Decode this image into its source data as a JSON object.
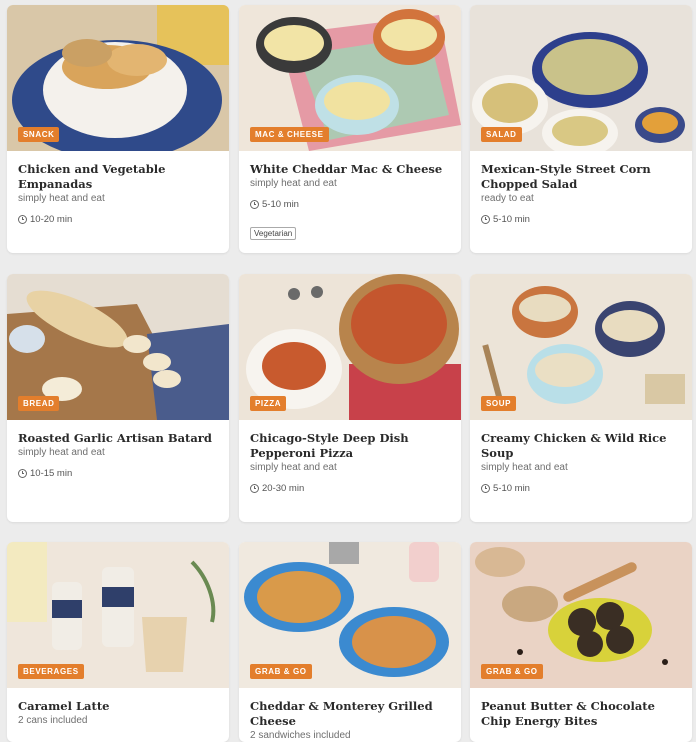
{
  "cards": [
    {
      "title": "Chicken and Vegetable Empanadas",
      "sub": "simply heat and eat",
      "time": "10-20 min",
      "badge": "SNACK"
    },
    {
      "title": "White Cheddar Mac & Cheese",
      "sub": "simply heat and eat",
      "time": "5-10 min",
      "badge": "MAC & CHEESE",
      "tag": "Vegetarian"
    },
    {
      "title": "Mexican-Style Street Corn Chopped Salad",
      "sub": "ready to eat",
      "time": "5-10 min",
      "badge": "SALAD"
    },
    {
      "title": "Roasted Garlic Artisan Batard",
      "sub": "simply heat and eat",
      "time": "10-15 min",
      "badge": "BREAD"
    },
    {
      "title": "Chicago-Style Deep Dish Pepperoni Pizza",
      "sub": "simply heat and eat",
      "time": "20-30 min",
      "badge": "PIZZA"
    },
    {
      "title": "Creamy Chicken & Wild Rice Soup",
      "sub": "simply heat and eat",
      "time": "5-10 min",
      "badge": "SOUP"
    },
    {
      "title": "Caramel Latte",
      "sub": "2 cans included",
      "badge": "BEVERAGES"
    },
    {
      "title": "Cheddar & Monterey Grilled Cheese",
      "sub": "2 sandwiches included",
      "badge": "GRAB & GO"
    },
    {
      "title": "Peanut Butter & Chocolate Chip Energy Bites",
      "badge": "GRAB & GO"
    }
  ],
  "colors": {
    "badge": "#e37e2c",
    "background": "#ececec"
  }
}
